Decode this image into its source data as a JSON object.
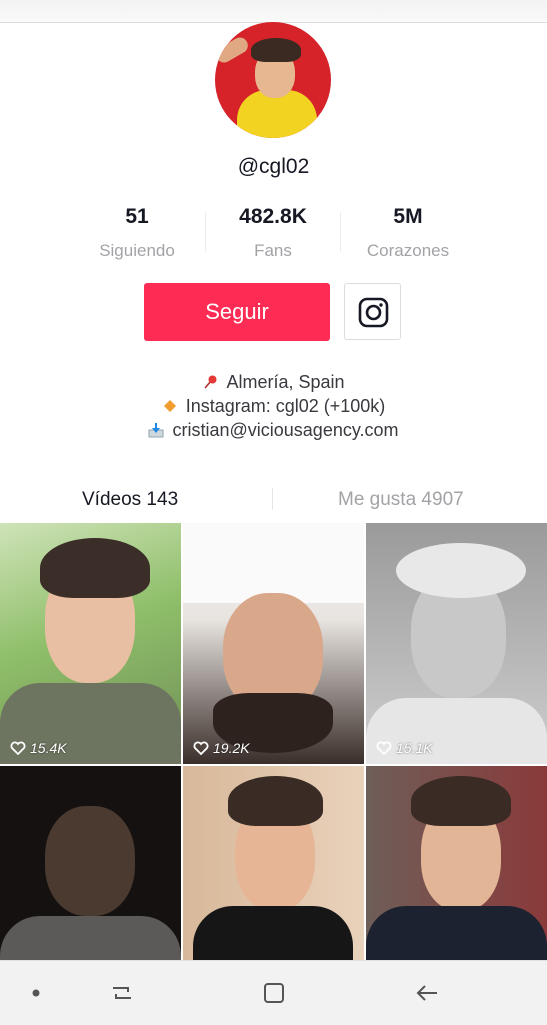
{
  "profile": {
    "username": "@cgl02",
    "stats": [
      {
        "value": "51",
        "label": "Siguiendo"
      },
      {
        "value": "482.8K",
        "label": "Fans"
      },
      {
        "value": "5M",
        "label": "Corazones"
      }
    ],
    "follow_label": "Seguir",
    "instagram_icon": "instagram-icon",
    "bio": [
      {
        "icon": "pin-icon",
        "text": "Almería, Spain"
      },
      {
        "icon": "diamond-icon",
        "text": "Instagram: cgl02 (+100k)"
      },
      {
        "icon": "inbox-icon",
        "text": "cristian@viciousagency.com"
      }
    ]
  },
  "tabs": [
    {
      "label": "Vídeos 143",
      "active": true
    },
    {
      "label": "Me gusta 4907",
      "active": false
    }
  ],
  "videos": [
    {
      "likes": "15.4K"
    },
    {
      "likes": "19.2K"
    },
    {
      "likes": "15.1K"
    },
    {
      "likes": ""
    },
    {
      "likes": ""
    },
    {
      "likes": ""
    }
  ],
  "nav": [
    "dot-icon",
    "recent-apps-icon",
    "home-icon",
    "back-icon"
  ],
  "colors": {
    "accent": "#fe2c55",
    "text": "#161823",
    "muted": "#a3a3a7"
  }
}
